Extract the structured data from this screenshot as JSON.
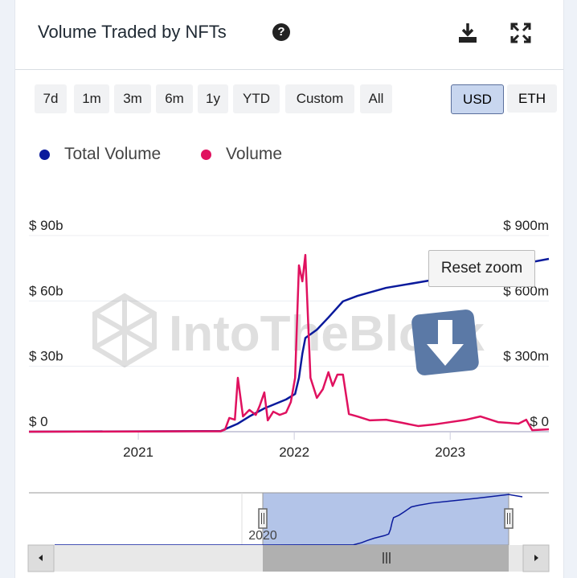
{
  "header": {
    "title": "Volume Traded by NFTs",
    "help_icon": "question-circle-icon",
    "download_icon": "download-icon",
    "fullscreen_icon": "expand-icon"
  },
  "ranges": [
    "7d",
    "1m",
    "3m",
    "6m",
    "1y",
    "YTD",
    "Custom",
    "All"
  ],
  "currency": {
    "options": [
      "USD",
      "ETH"
    ],
    "selected": "USD"
  },
  "reset_zoom": "Reset zoom",
  "watermark": "IntoTheBlock",
  "navigator": {
    "label": "2020"
  },
  "chart_data": {
    "type": "line",
    "title": "Volume Traded by NFTs",
    "x_range": [
      "2020-04-20",
      "2023-08-20"
    ],
    "x_ticks": [
      "2021",
      "2022",
      "2023"
    ],
    "y_left": {
      "ticks": [
        "$ 0",
        "$ 30b",
        "$ 60b",
        "$ 90b"
      ],
      "range": [
        0,
        90
      ],
      "unit": "billion USD"
    },
    "y_right": {
      "ticks": [
        "$ 0",
        "$ 300m",
        "$ 600m",
        "$ 900m"
      ],
      "range": [
        0,
        900
      ],
      "unit": "million USD"
    },
    "grid": true,
    "legend_position": "top-left",
    "series": [
      {
        "name": "Total Volume",
        "axis": "left",
        "color": "#0a1a9c",
        "points": [
          [
            "2020-04-20",
            0
          ],
          [
            "2021-07-13",
            0.3
          ],
          [
            "2021-08-22",
            3.7
          ],
          [
            "2021-09-18",
            7
          ],
          [
            "2021-10-23",
            10.7
          ],
          [
            "2021-12-13",
            14.8
          ],
          [
            "2022-01-03",
            17.3
          ],
          [
            "2022-01-12",
            24.7
          ],
          [
            "2022-01-20",
            35.8
          ],
          [
            "2022-01-27",
            43
          ],
          [
            "2022-02-23",
            46.8
          ],
          [
            "2022-03-22",
            52.4
          ],
          [
            "2022-04-25",
            59.8
          ],
          [
            "2022-05-29",
            62.3
          ],
          [
            "2022-08-04",
            66
          ],
          [
            "2022-11-24",
            69.7
          ],
          [
            "2023-03-13",
            73.4
          ],
          [
            "2023-08-20",
            79.3
          ]
        ]
      },
      {
        "name": "Volume",
        "axis": "right",
        "color": "#e0115f",
        "points": [
          [
            "2020-04-20",
            0
          ],
          [
            "2021-01-01",
            1
          ],
          [
            "2021-05-01",
            2
          ],
          [
            "2021-07-13",
            2
          ],
          [
            "2021-07-23",
            10
          ],
          [
            "2021-08-02",
            63
          ],
          [
            "2021-08-15",
            55
          ],
          [
            "2021-08-22",
            247
          ],
          [
            "2021-09-03",
            70
          ],
          [
            "2021-09-18",
            100
          ],
          [
            "2021-10-03",
            77
          ],
          [
            "2021-10-12",
            118
          ],
          [
            "2021-10-23",
            180
          ],
          [
            "2021-10-31",
            52
          ],
          [
            "2021-11-13",
            92
          ],
          [
            "2021-11-28",
            77
          ],
          [
            "2021-12-13",
            88
          ],
          [
            "2021-12-24",
            136
          ],
          [
            "2022-01-03",
            247
          ],
          [
            "2022-01-12",
            763
          ],
          [
            "2022-01-20",
            690
          ],
          [
            "2022-01-27",
            811
          ],
          [
            "2022-02-08",
            247
          ],
          [
            "2022-02-23",
            155
          ],
          [
            "2022-03-09",
            195
          ],
          [
            "2022-03-22",
            273
          ],
          [
            "2022-04-01",
            210
          ],
          [
            "2022-04-12",
            262
          ],
          [
            "2022-04-25",
            262
          ],
          [
            "2022-05-09",
            81
          ],
          [
            "2022-05-29",
            70
          ],
          [
            "2022-06-27",
            52
          ],
          [
            "2022-08-04",
            55
          ],
          [
            "2022-09-10",
            41
          ],
          [
            "2022-10-18",
            26
          ],
          [
            "2022-11-24",
            33
          ],
          [
            "2023-01-01",
            44
          ],
          [
            "2023-02-08",
            55
          ],
          [
            "2023-03-13",
            70
          ],
          [
            "2023-04-23",
            44
          ],
          [
            "2023-06-10",
            37
          ],
          [
            "2023-06-28",
            55
          ],
          [
            "2023-07-12",
            7
          ],
          [
            "2023-08-20",
            11
          ]
        ]
      }
    ]
  }
}
